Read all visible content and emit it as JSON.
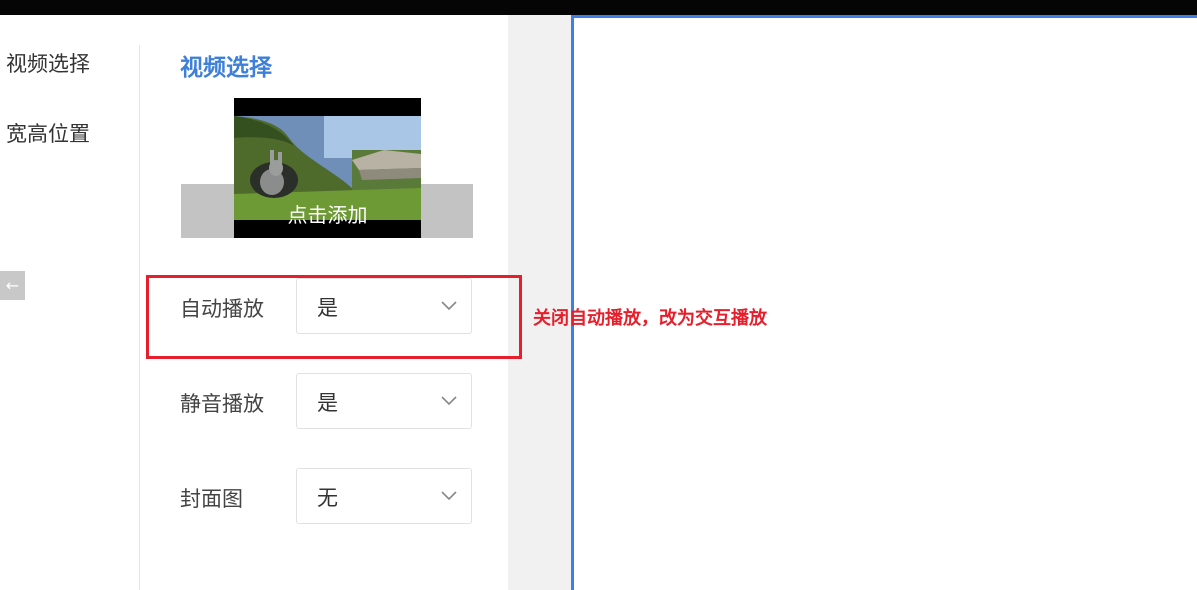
{
  "nav": {
    "items": [
      {
        "label": "视频选择"
      },
      {
        "label": "宽高位置"
      }
    ],
    "back_icon": "←"
  },
  "panel": {
    "section_title": "视频选择",
    "video": {
      "add_label": "点击添加"
    },
    "fields": [
      {
        "label": "自动播放",
        "value": "是"
      },
      {
        "label": "静音播放",
        "value": "是"
      },
      {
        "label": "封面图",
        "value": "无"
      }
    ]
  },
  "annotation": {
    "text": "关闭自动播放，改为交互播放"
  },
  "colors": {
    "accent": "#3d7fd9",
    "highlight": "#e51f2b",
    "preview_border": "#3f7ee8"
  }
}
